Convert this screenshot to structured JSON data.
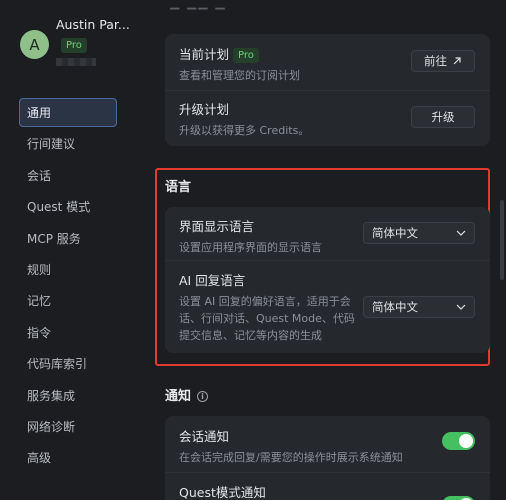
{
  "user": {
    "avatar_letter": "A",
    "name": "Austin Par...",
    "plan_badge": "Pro"
  },
  "sidebar": {
    "items": [
      {
        "label": "通用"
      },
      {
        "label": "行间建议"
      },
      {
        "label": "会话"
      },
      {
        "label": "Quest 模式"
      },
      {
        "label": "MCP 服务"
      },
      {
        "label": "规则"
      },
      {
        "label": "记忆"
      },
      {
        "label": "指令"
      },
      {
        "label": "代码库索引"
      },
      {
        "label": "服务集成"
      },
      {
        "label": "网络诊断"
      },
      {
        "label": "高级"
      }
    ]
  },
  "plan": {
    "current_title": "当前计划",
    "current_badge": "Pro",
    "current_desc": "查看和管理您的订阅计划",
    "current_button": "前往",
    "upgrade_title": "升级计划",
    "upgrade_desc": "升级以获得更多 Credits。",
    "upgrade_button": "升级"
  },
  "language": {
    "section_title": "语言",
    "ui_title": "界面显示语言",
    "ui_desc": "设置应用程序界面的显示语言",
    "ui_value": "简体中文",
    "ai_title": "AI 回复语言",
    "ai_desc_line1": "设置 AI 回复的偏好语言，适用于会",
    "ai_desc_line2": "话、行间对话、Quest Mode、代码",
    "ai_desc_line3": "提交信息、记忆等内容的生成",
    "ai_value": "简体中文"
  },
  "notifications": {
    "section_title": "通知",
    "session_title": "会话通知",
    "session_desc": "在会话完成回复/需要您的操作时展示系统通知",
    "session_enabled": true,
    "quest_title": "Quest模式通知",
    "quest_enabled": true
  },
  "colors": {
    "accent_green": "#45c061",
    "highlight_red": "#e33a2e",
    "active_nav": "#2a3445"
  }
}
